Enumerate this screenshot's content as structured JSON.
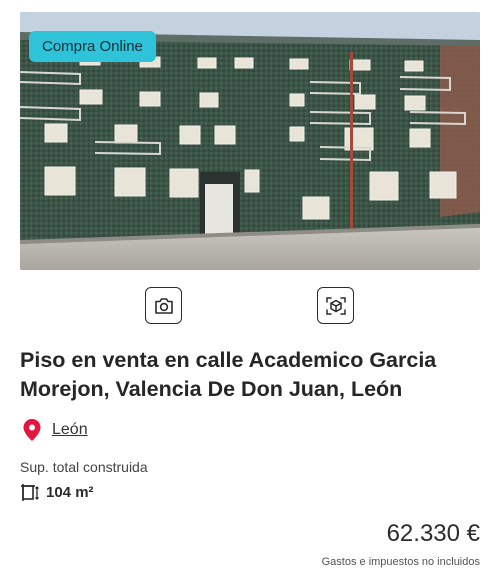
{
  "listing": {
    "badge": "Compra Online",
    "title": "Piso en venta en calle Academico Garcia Morejon, Valencia De Don Juan, León",
    "location": "León",
    "surface_label": "Sup. total construida",
    "surface_value": "104 m²",
    "price": "62.330 €",
    "price_note": "Gastos e impuestos no incluidos"
  },
  "icons": {
    "photos": "camera-icon",
    "tour": "virtual-tour-icon",
    "location": "location-pin-icon",
    "surface": "area-icon"
  },
  "colors": {
    "badge": "#2ec3d8",
    "pin": "#e2173f",
    "facade": "#3d5548"
  }
}
